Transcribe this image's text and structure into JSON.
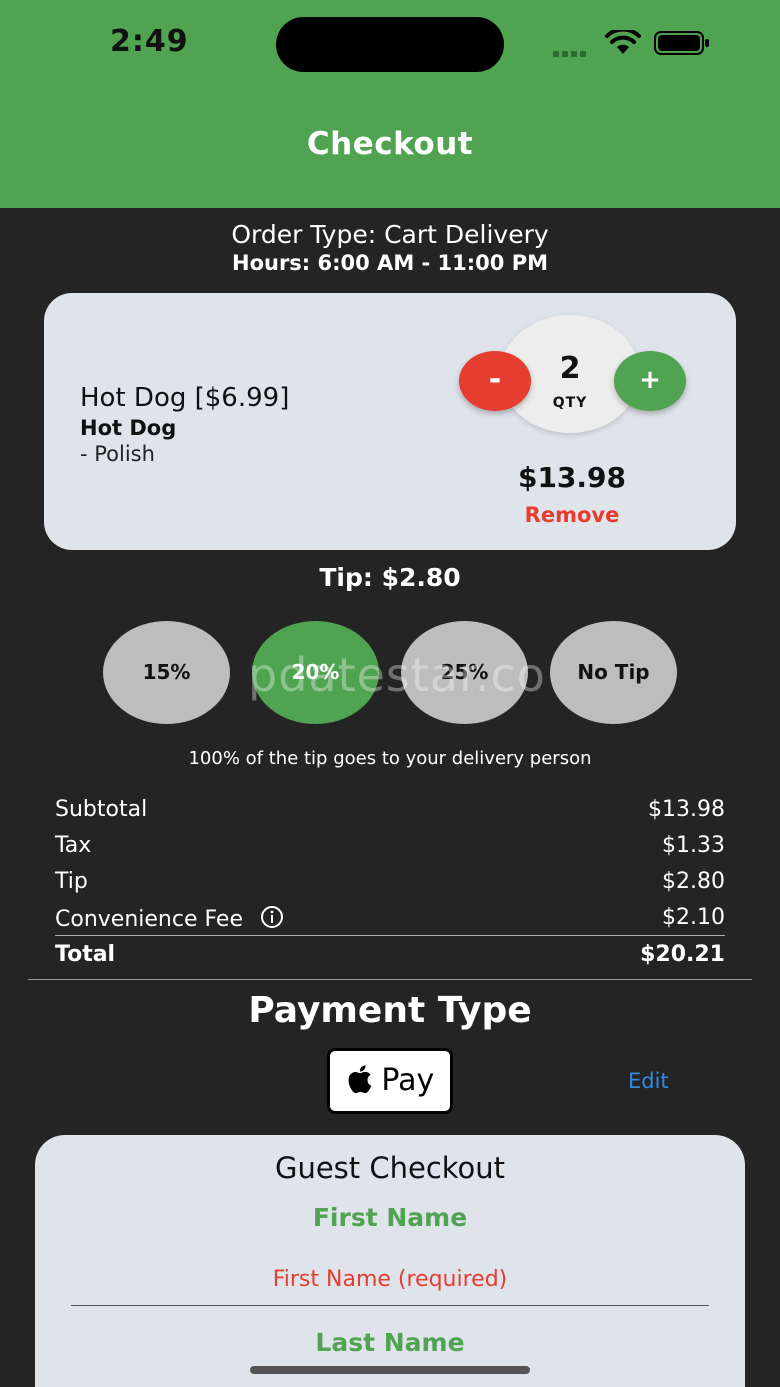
{
  "status_bar": {
    "time": "2:49"
  },
  "header": {
    "title": "Checkout"
  },
  "order": {
    "type_label": "Order Type: Cart Delivery",
    "hours_label": "Hours: 6:00 AM - 11:00 PM"
  },
  "item": {
    "name": "Hot Dog [$6.99]",
    "subtitle": "Hot Dog",
    "modifier": "- Polish",
    "quantity": "2",
    "qty_label": "QTY",
    "minus_label": "-",
    "plus_label": "+",
    "price": "$13.98",
    "remove_label": "Remove"
  },
  "tip": {
    "heading": "Tip: $2.80",
    "options": [
      "15%",
      "20%",
      "25%",
      "No Tip"
    ],
    "selected": "20%",
    "note": "100% of the tip goes to your delivery person"
  },
  "summary": {
    "rows": [
      {
        "label": "Subtotal",
        "value": "$13.98"
      },
      {
        "label": "Tax",
        "value": "$1.33"
      },
      {
        "label": "Tip",
        "value": "$2.80"
      },
      {
        "label": "Convenience Fee",
        "value": "$2.10"
      }
    ],
    "total": {
      "label": "Total",
      "value": "$20.21"
    }
  },
  "payment": {
    "heading": "Payment Type",
    "method_label": "Pay",
    "edit_label": "Edit"
  },
  "guest": {
    "title": "Guest Checkout",
    "first_name_label": "First Name",
    "first_name_placeholder": "First Name (required)",
    "last_name_label": "Last Name"
  },
  "watermark": "pdatestar.co",
  "colors": {
    "header_green": "#4fa351",
    "background": "#242424",
    "card": "#dfe3ea",
    "danger_red": "#e53d30",
    "link_blue": "#2f8be0"
  },
  "icons": [
    "wifi-icon",
    "battery-icon",
    "info-icon",
    "apple-logo-icon"
  ]
}
